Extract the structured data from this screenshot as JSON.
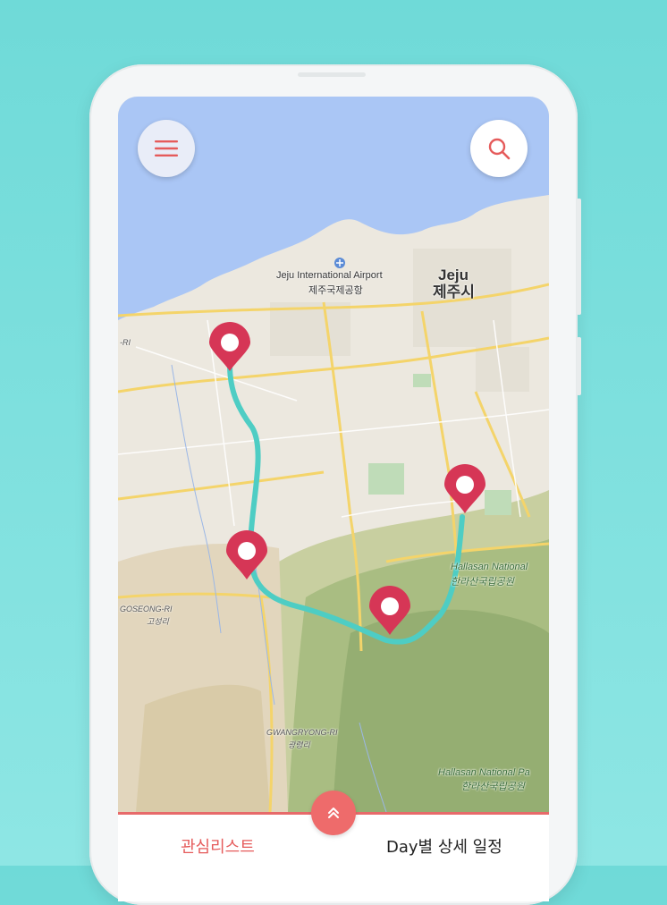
{
  "map": {
    "labels": {
      "airport_en": "Jeju International Airport",
      "airport_ko": "제주국제공항",
      "city_en": "Jeju",
      "city_ko": "제주시",
      "park1_en": "Hallasan National",
      "park1_ko": "한라산국립공원",
      "park2_en": "Hallasan National Pa",
      "park2_ko": "한라산국립공원",
      "goseong_en": "GOSEONG-RI",
      "goseong_ko": "고성리",
      "gwangryong_en": "GWANGRYONG-RI",
      "gwangryong_ko": "광령리",
      "edge_ri": "-RI"
    },
    "markers": [
      "marker-1",
      "marker-2",
      "marker-3",
      "marker-4"
    ],
    "route_color": "#4ecdc4",
    "marker_color": "#d63656"
  },
  "buttons": {
    "menu_icon": "hamburger-icon",
    "search_icon": "search-icon",
    "expand_icon": "double-chevron-up-icon"
  },
  "bottom_sheet": {
    "tab_left": "관심리스트",
    "tab_right": "Day별 상세 일정",
    "accent_color": "#e55b5b"
  }
}
